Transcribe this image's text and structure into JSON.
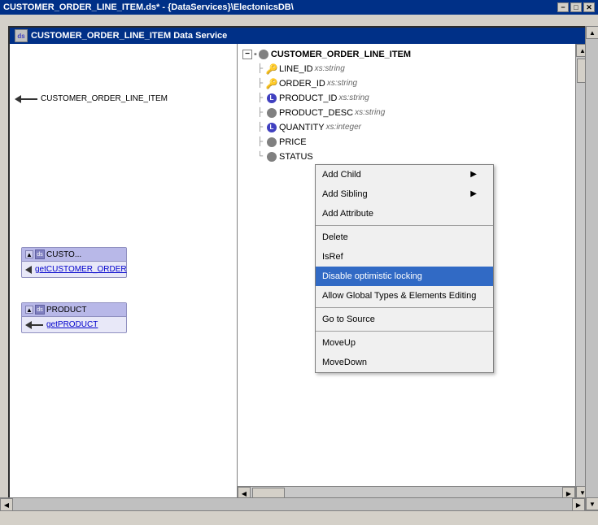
{
  "titleBar": {
    "title": "CUSTOMER_ORDER_LINE_ITEM.ds* - {DataServices}\\ElectonicsDB\\",
    "closeBtn": "✕",
    "maxBtn": "□",
    "minBtn": "−"
  },
  "panel": {
    "iconLabel": "ds",
    "title": "CUSTOMER_ORDER_LINE_ITEM",
    "titleSuffix": " Data Service"
  },
  "leftCanvas": {
    "rootArrowLabel": "CUSTOMER_ORDER_LINE_ITEM",
    "card1": {
      "name": "CUSTO...",
      "link": "getCUSTOMER_ORDER"
    },
    "card2": {
      "name": "PRODUCT",
      "link": "getPRODUCT"
    }
  },
  "tree": {
    "root": {
      "name": "CUSTOMER_ORDER_LINE_ITEM",
      "iconType": "gray"
    },
    "items": [
      {
        "name": "LINE_ID",
        "type": "xs:string",
        "iconType": "key",
        "indent": 1
      },
      {
        "name": "ORDER_ID",
        "type": "xs:string",
        "iconType": "key",
        "indent": 1
      },
      {
        "name": "PRODUCT_ID",
        "type": "xs:string",
        "iconType": "blue",
        "indent": 1
      },
      {
        "name": "PRODUCT_DESC",
        "type": "xs:string",
        "iconType": "gray",
        "indent": 1
      },
      {
        "name": "QUANTITY",
        "type": "xs:integer",
        "iconType": "blue",
        "indent": 1
      },
      {
        "name": "PRICE",
        "type": "",
        "iconType": "gray",
        "indent": 1
      },
      {
        "name": "STATUS",
        "type": "",
        "iconType": "gray",
        "indent": 1
      }
    ]
  },
  "contextMenu": {
    "items": [
      {
        "label": "Add Child",
        "hasArrow": true,
        "type": "normal"
      },
      {
        "label": "Add Sibling",
        "hasArrow": true,
        "type": "normal"
      },
      {
        "label": "Add Attribute",
        "hasArrow": false,
        "type": "normal"
      },
      {
        "label": "separator1",
        "type": "separator"
      },
      {
        "label": "Delete",
        "hasArrow": false,
        "type": "normal"
      },
      {
        "label": "IsRef",
        "hasArrow": false,
        "type": "normal"
      },
      {
        "label": "Disable optimistic locking",
        "hasArrow": false,
        "type": "active"
      },
      {
        "label": "Allow Global Types & Elements Editing",
        "hasArrow": false,
        "type": "normal"
      },
      {
        "label": "separator2",
        "type": "separator"
      },
      {
        "label": "Go to Source",
        "hasArrow": false,
        "type": "normal"
      },
      {
        "label": "separator3",
        "type": "separator"
      },
      {
        "label": "MoveUp",
        "hasArrow": false,
        "type": "normal"
      },
      {
        "label": "MoveDown",
        "hasArrow": false,
        "type": "normal"
      }
    ]
  }
}
